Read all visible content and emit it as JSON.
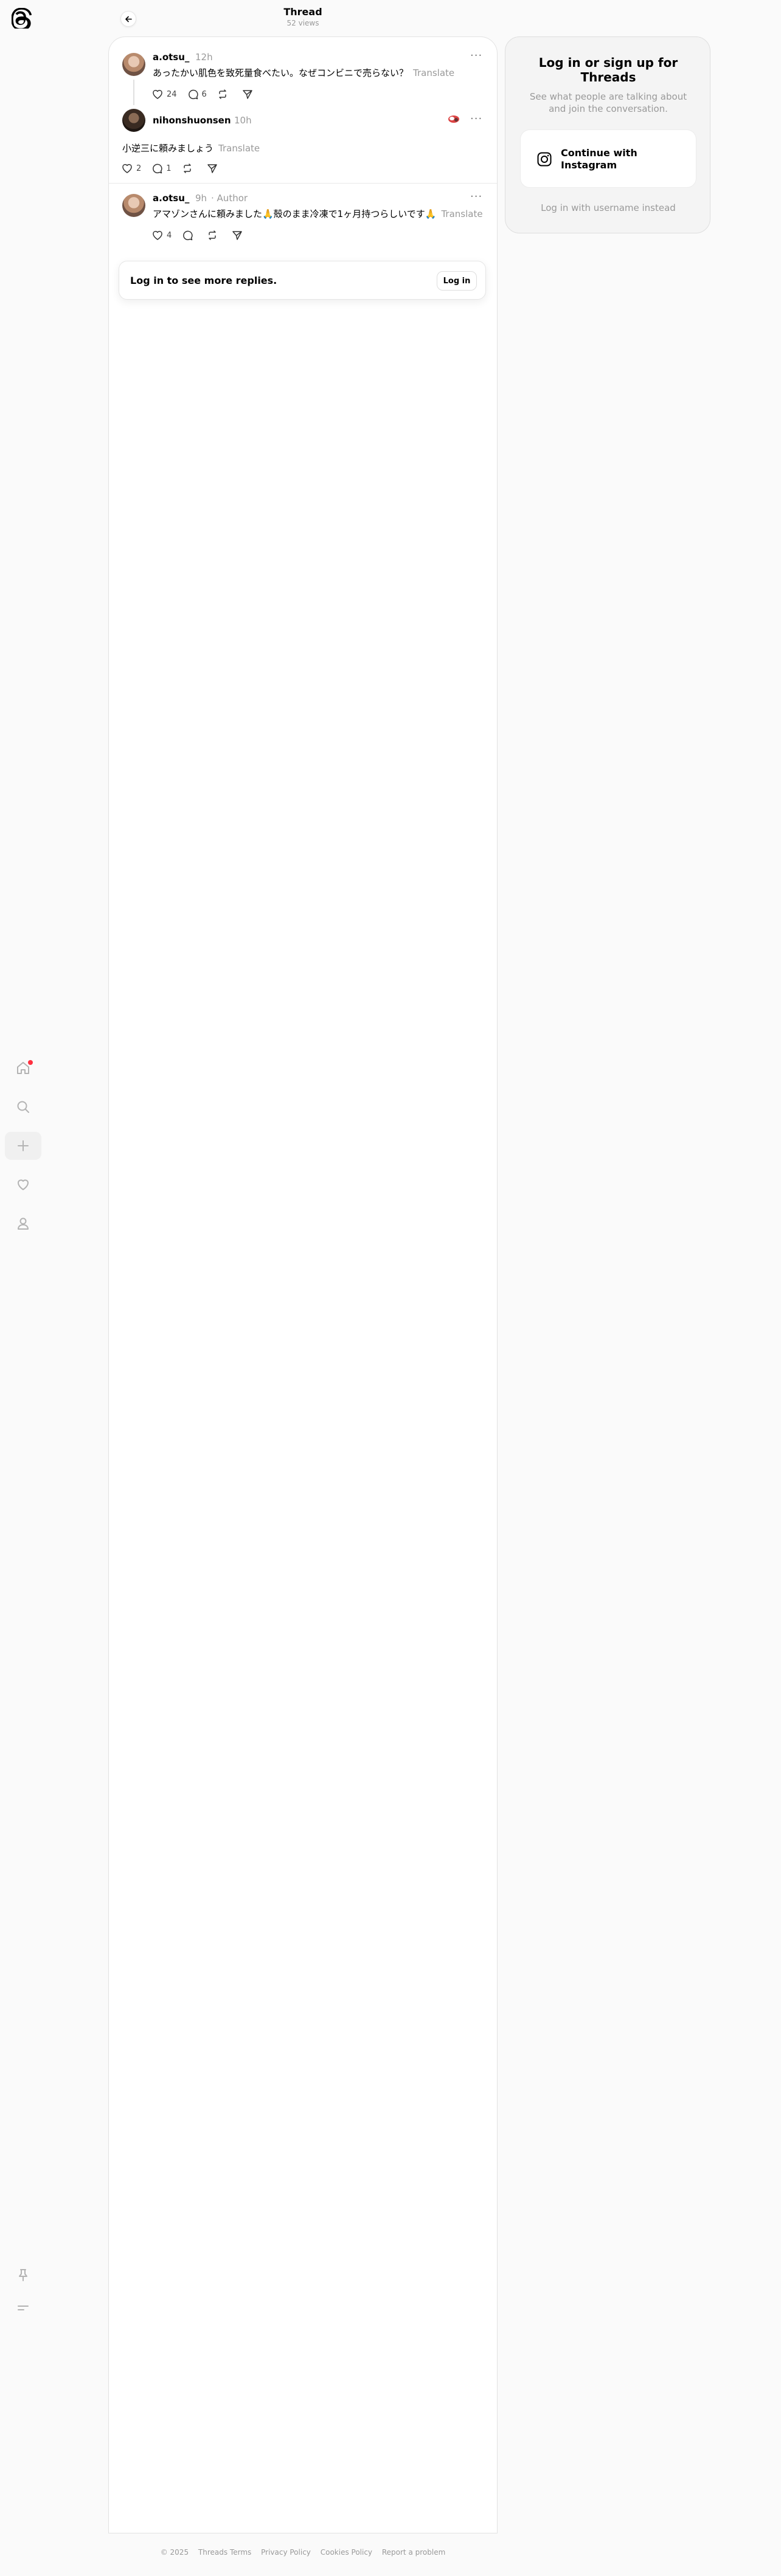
{
  "header": {
    "title": "Thread",
    "views": "52 views"
  },
  "nav": {
    "icons": [
      "threads-logo-icon",
      "home-icon",
      "search-icon",
      "plus-icon",
      "heart-icon",
      "user-icon",
      "pin-icon",
      "menu-icon"
    ]
  },
  "posts": [
    {
      "username": "a.otsu_",
      "time": "12h",
      "text": "あったかい肌色を致死量食べたい。なぜコンビニで売らない？",
      "translate": "Translate",
      "likes": "24",
      "replies": "6"
    },
    {
      "username": "nihonshuonsen",
      "time": "10h",
      "text": "小逆三に頼みましょう",
      "translate": "Translate",
      "likes": "2",
      "replies": "1"
    },
    {
      "username": "a.otsu_",
      "time": "9h",
      "author_badge": "Author",
      "text": "アマゾンさんに頼みました🙏殻のまま冷凍で1ヶ月持つらしいです🙏",
      "translate": "Translate",
      "likes": "4",
      "replies": ""
    }
  ],
  "login_card": {
    "text": "Log in to see more replies.",
    "button": "Log in"
  },
  "side_panel": {
    "title": "Log in or sign up for Threads",
    "subtitle": "See what people are talking about and join the conversation.",
    "instagram_button": "Continue with Instagram",
    "username_link": "Log in with username instead"
  },
  "footer": {
    "copyright": "© 2025",
    "links": [
      "Threads Terms",
      "Privacy Policy",
      "Cookies Policy",
      "Report a problem"
    ]
  },
  "colors": {
    "notification_dot": "#ff3040",
    "muted_text": "#999999"
  }
}
